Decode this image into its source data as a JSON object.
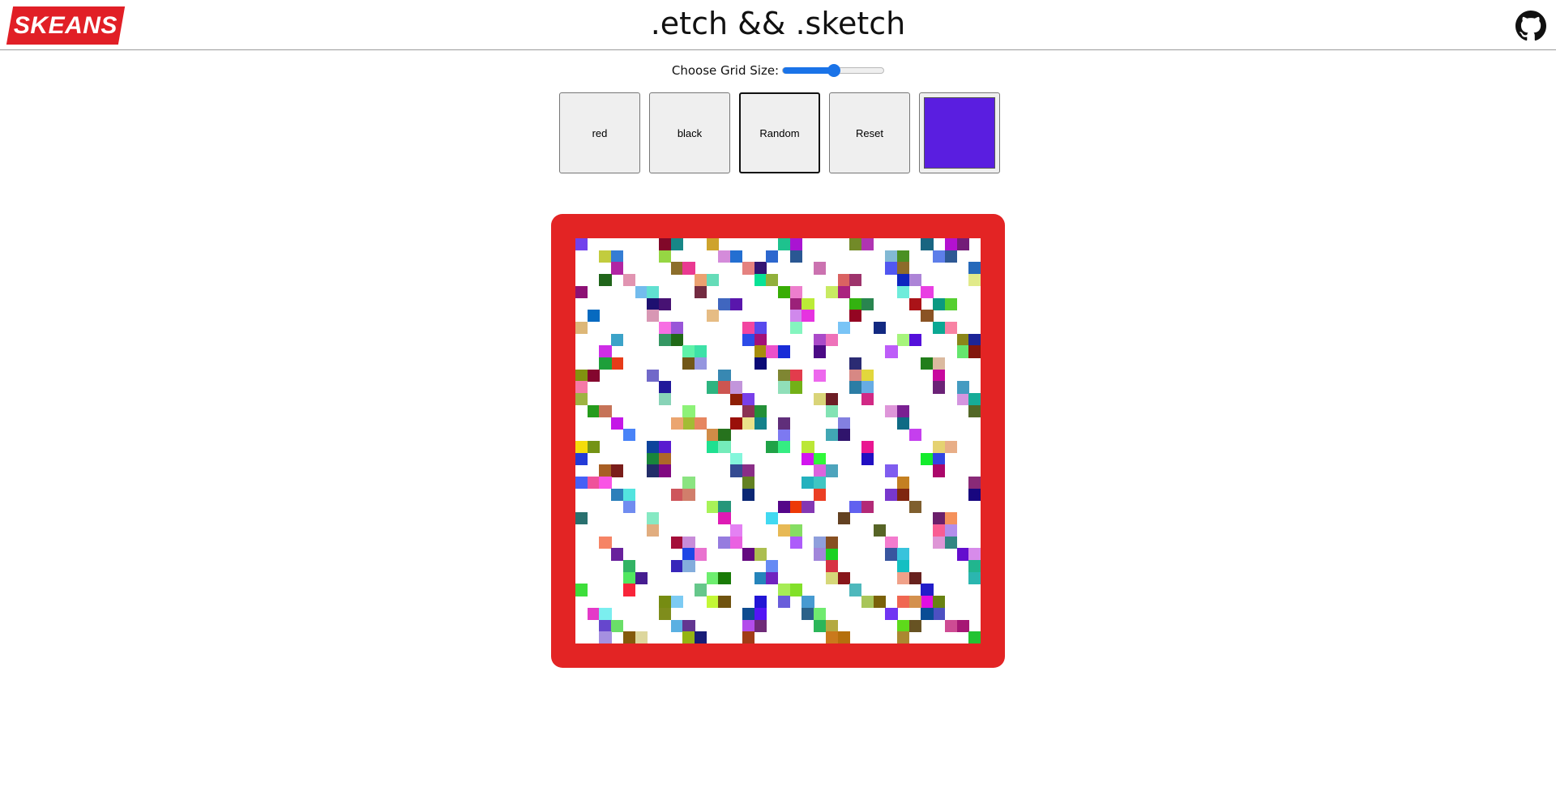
{
  "header": {
    "logo_text": "SKEANS",
    "title": ".etch && .sketch",
    "github_icon": "github-icon"
  },
  "controls": {
    "grid_size_label": "Choose Grid Size:",
    "grid_size_fraction": 0.5
  },
  "buttons": {
    "red_label": "red",
    "black_label": "black",
    "random_label": "Random",
    "reset_label": "Reset",
    "active": "Random"
  },
  "color_picker": {
    "value": "#5a1ee0"
  },
  "colors": {
    "accent": "#e11f26",
    "board_frame": "#e32424",
    "slider": "#1a73e8"
  }
}
